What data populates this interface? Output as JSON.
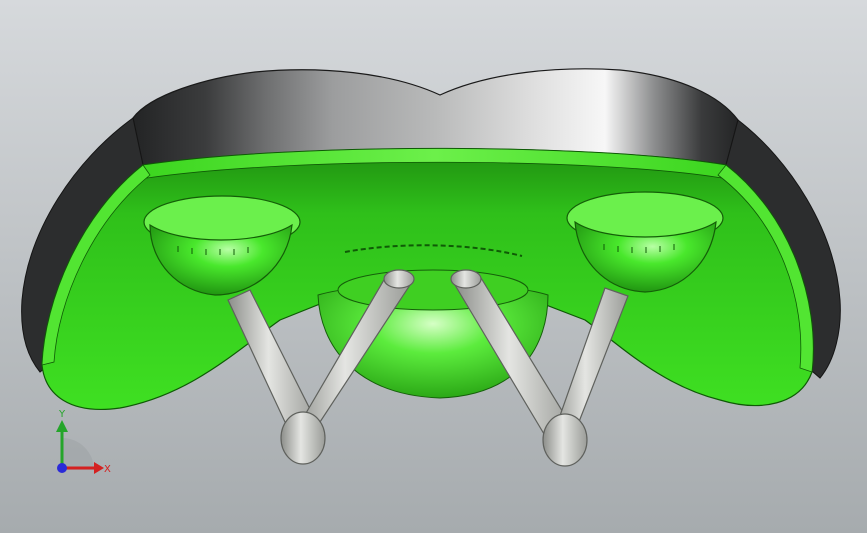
{
  "viewport": {
    "background_top": "#d6d9dc",
    "background_bottom": "#a6abae"
  },
  "model": {
    "primary_color": "#35e219",
    "shell_dark": "#2e2f30",
    "shell_light": "#f4f4f4",
    "rail_color": "#c8cac6"
  },
  "triad": {
    "y_label": "Y",
    "x_label": "X",
    "y_color": "#25a52a",
    "x_color": "#d42020",
    "z_color": "#2a2ad8",
    "icons": [
      "y-axis-arrow-icon",
      "x-axis-arrow-icon",
      "z-axis-dot-icon"
    ]
  }
}
